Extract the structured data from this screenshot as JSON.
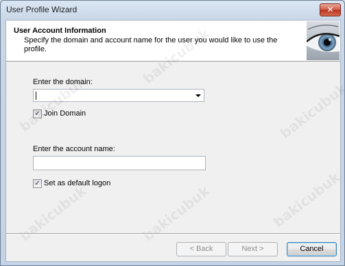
{
  "window": {
    "title": "User Profile Wizard",
    "close_glyph": "✕"
  },
  "header": {
    "title": "User Account Information",
    "subtitle": "Specify the domain and account name for the user you would like to use the profile.",
    "image_icon": "eye-icon"
  },
  "form": {
    "domain_label": "Enter the domain:",
    "domain_value": "",
    "join_domain": {
      "label": "Join Domain",
      "checked": true
    },
    "account_label": "Enter the account name:",
    "account_value": "",
    "default_logon": {
      "label": "Set as default logon",
      "checked": true
    }
  },
  "buttons": {
    "back": "< Back",
    "next": "Next >",
    "cancel": "Cancel"
  },
  "watermark": "bakicubuk",
  "colors": {
    "accent": "#3c7fb1",
    "close": "#c8412a"
  }
}
